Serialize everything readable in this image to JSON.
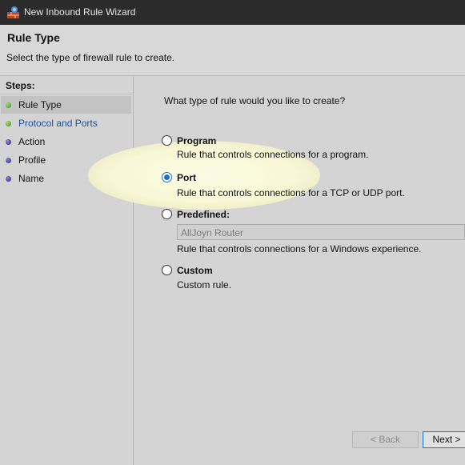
{
  "window": {
    "title": "New Inbound Rule Wizard",
    "icon": "firewall-wizard-icon"
  },
  "header": {
    "title": "Rule Type",
    "subtitle": "Select the type of firewall rule to create."
  },
  "steps": {
    "heading": "Steps:",
    "items": [
      {
        "label": "Rule Type",
        "status": "completed",
        "active": true
      },
      {
        "label": "Protocol and Ports",
        "status": "completed",
        "active": false
      },
      {
        "label": "Action",
        "status": "pending",
        "active": false
      },
      {
        "label": "Profile",
        "status": "pending",
        "active": false
      },
      {
        "label": "Name",
        "status": "pending",
        "active": false
      }
    ]
  },
  "main": {
    "question": "What type of rule would you like to create?",
    "options": {
      "program": {
        "label": "Program",
        "description": "Rule that controls connections for a program.",
        "selected": false
      },
      "port": {
        "label": "Port",
        "description": "Rule that controls connections for a TCP or UDP port.",
        "selected": true
      },
      "predefined": {
        "label": "Predefined:",
        "description": "Rule that controls connections for a Windows experience.",
        "selected": false,
        "dropdown_value": "AllJoyn Router"
      },
      "custom": {
        "label": "Custom",
        "description": "Custom rule.",
        "selected": false
      }
    }
  },
  "footer": {
    "back_label": "< Back",
    "next_label": "Next >"
  },
  "colors": {
    "selection_accent": "#1c6fd1",
    "step_done": "#3a9a1e",
    "step_pending": "#332a8c",
    "link": "#1f4fa0"
  }
}
